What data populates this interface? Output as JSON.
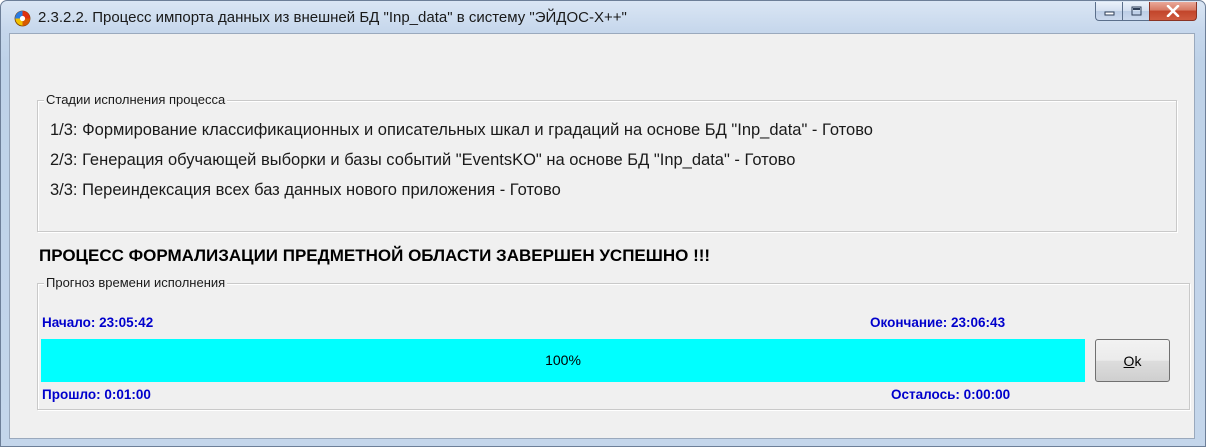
{
  "window": {
    "title": "2.3.2.2. Процесс импорта данных из внешней БД \"Inp_data\" в систему \"ЭЙДОС-X++\""
  },
  "controls": {
    "minimize_icon": "minimize-icon",
    "maximize_icon": "maximize-icon",
    "close_icon": "close-icon"
  },
  "stages": {
    "legend": "Стадии исполнения процесса",
    "lines": [
      "1/3: Формирование классификационных и описательных шкал и градаций на основе БД \"Inp_data\" - Готово",
      "2/3: Генерация обучающей выборки и базы событий \"EventsKO\" на основе БД \"Inp_data\" - Готово",
      "3/3: Переиндексация всех баз данных нового приложения - Готово"
    ]
  },
  "headline": "ПРОЦЕСС ФОРМАЛИЗАЦИИ ПРЕДМЕТНОЙ ОБЛАСТИ ЗАВЕРШЕН УСПЕШНО !!!",
  "forecast": {
    "legend": "Прогноз времени исполнения",
    "start": "Начало: 23:05:42",
    "end": "Окончание: 23:06:43",
    "elapsed": "Прошло: 0:01:00",
    "remaining": "Осталось: 0:00:00",
    "progress_percent": 100,
    "progress_label": "100%"
  },
  "ok_button": {
    "accel": "O",
    "rest": "k"
  },
  "colors": {
    "progress_fill": "#00ffff",
    "time_labels": "#0000cc"
  }
}
